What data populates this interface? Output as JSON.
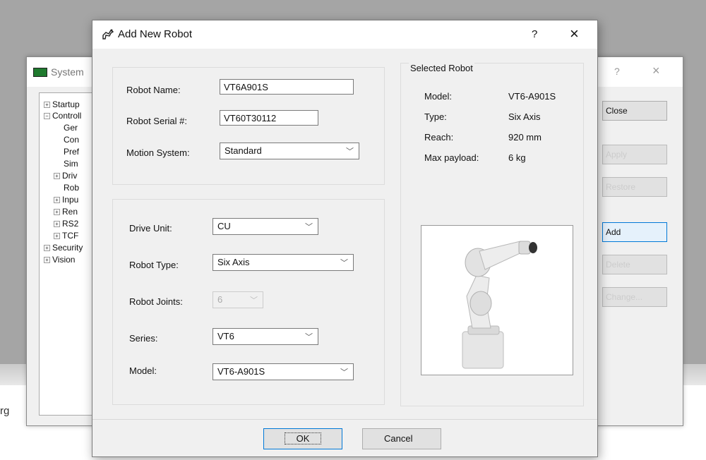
{
  "background": {
    "left_text": "rg"
  },
  "system_window": {
    "title": "System",
    "help_label": "?",
    "close_label": "×",
    "tree": [
      {
        "label": "Startup",
        "expander": "+"
      },
      {
        "label": "Controll",
        "expander": "−"
      },
      {
        "label": "Ger",
        "expander": ""
      },
      {
        "label": "Con",
        "expander": ""
      },
      {
        "label": "Pref",
        "expander": ""
      },
      {
        "label": "Sim",
        "expander": ""
      },
      {
        "label": "Driv",
        "expander": "+"
      },
      {
        "label": "Rob",
        "expander": ""
      },
      {
        "label": "Inpu",
        "expander": "+"
      },
      {
        "label": "Ren",
        "expander": "+"
      },
      {
        "label": "RS2",
        "expander": "+"
      },
      {
        "label": "TCF",
        "expander": "+"
      },
      {
        "label": "Security",
        "expander": "+"
      },
      {
        "label": "Vision",
        "expander": "+"
      }
    ],
    "buttons": {
      "close": "Close",
      "apply": "Apply",
      "restore": "Restore",
      "add": "Add",
      "delete": "Delete",
      "change": "Change..."
    }
  },
  "dialog": {
    "title": "Add New Robot",
    "help_label": "?",
    "close_label": "×",
    "robot_name": {
      "label": "Robot Name:",
      "value": "VT6A901S"
    },
    "robot_serial": {
      "label": "Robot Serial #:",
      "value": "VT60T30112"
    },
    "motion_system": {
      "label": "Motion System:",
      "value": "Standard"
    },
    "drive_unit": {
      "label": "Drive Unit:",
      "value": "CU"
    },
    "robot_type": {
      "label": "Robot Type:",
      "value": "Six Axis"
    },
    "robot_joints": {
      "label": "Robot Joints:",
      "value": "6"
    },
    "series": {
      "label": "Series:",
      "value": "VT6"
    },
    "model": {
      "label": "Model:",
      "value": "VT6-A901S"
    },
    "selected_robot": {
      "heading": "Selected Robot",
      "rows": [
        {
          "label": "Model:",
          "value": "VT6-A901S"
        },
        {
          "label": "Type:",
          "value": "Six Axis"
        },
        {
          "label": "Reach:",
          "value": "920 mm"
        },
        {
          "label": "Max payload:",
          "value": "6 kg"
        }
      ]
    },
    "ok_label": "OK",
    "cancel_label": "Cancel"
  }
}
